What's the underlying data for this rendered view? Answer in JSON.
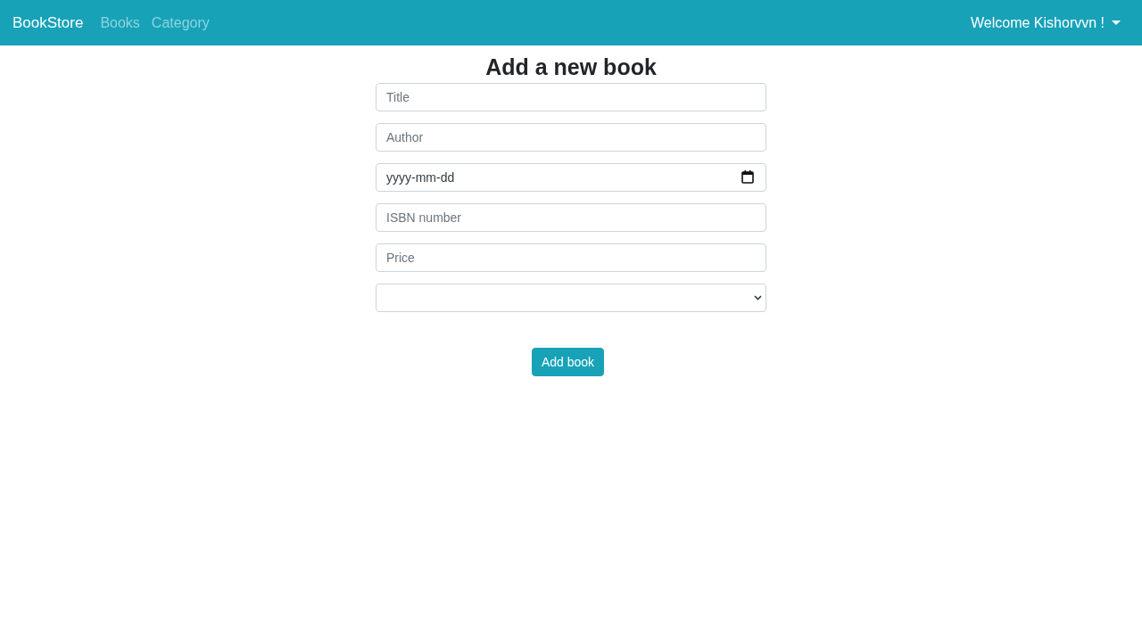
{
  "navbar": {
    "brand": "BookStore",
    "links": [
      {
        "label": "Books"
      },
      {
        "label": "Category"
      }
    ],
    "user_menu": {
      "label": "Welcome Kishorvvn !"
    }
  },
  "form": {
    "title": "Add a new book",
    "fields": [
      {
        "kind": "text",
        "placeholder": "Title"
      },
      {
        "kind": "text",
        "placeholder": "Author"
      },
      {
        "kind": "date",
        "placeholder": "yyyy-mm-dd"
      },
      {
        "kind": "text",
        "placeholder": "ISBN number"
      },
      {
        "kind": "text",
        "placeholder": "Price"
      },
      {
        "kind": "select"
      }
    ],
    "submit_button": "Add book"
  }
}
